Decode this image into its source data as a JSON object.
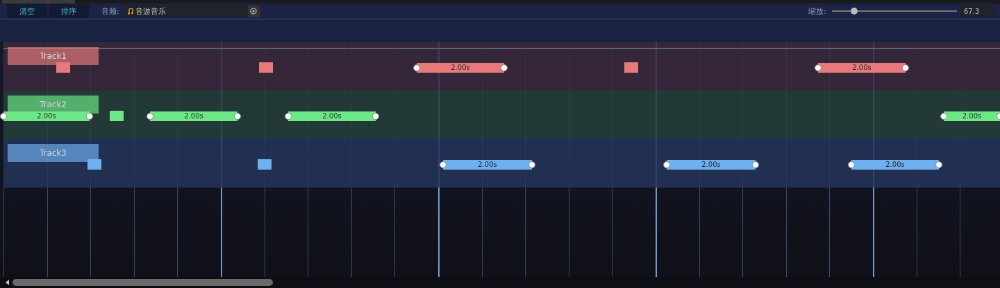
{
  "toolbar": {
    "buttons": [
      "清空",
      "排序"
    ],
    "audio": {
      "label": "音频:",
      "value": "音游音乐"
    },
    "zoom": {
      "label": "缩放:",
      "level": 0.18,
      "value": "67.3"
    }
  },
  "tracks": [
    {
      "name": "Track1",
      "color": "#e8797b",
      "notes": [
        {
          "kind": "tap"
        },
        {
          "kind": "tap"
        },
        {
          "kind": "hold",
          "label": "2.00s"
        },
        {
          "kind": "tap"
        },
        {
          "kind": "hold",
          "label": "2.00s"
        }
      ]
    },
    {
      "name": "Track2",
      "color": "#6ee887",
      "notes": [
        {
          "kind": "hold",
          "label": "2.00s"
        },
        {
          "kind": "tap"
        },
        {
          "kind": "hold",
          "label": "2.00s"
        },
        {
          "kind": "hold",
          "label": "2.00s"
        },
        {
          "kind": "hold",
          "label": "2.00s"
        }
      ]
    },
    {
      "name": "Track3",
      "color": "#6fb0f0",
      "notes": [
        {
          "kind": "tap"
        },
        {
          "kind": "tap"
        },
        {
          "kind": "hold",
          "label": "2.00s"
        },
        {
          "kind": "hold",
          "label": "2.00s"
        },
        {
          "kind": "hold",
          "label": "2.00s"
        }
      ]
    }
  ]
}
